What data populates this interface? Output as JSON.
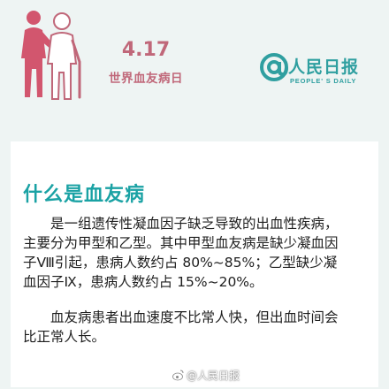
{
  "header": {
    "date": "4.17",
    "event_name": "世界血友病日",
    "brand_name": "人民日报",
    "brand_en": "PEOPLE' S DAILY"
  },
  "card": {
    "title": "什么是血友病",
    "paragraphs": [
      "　　是一组遗传性凝血因子缺乏导致的出血性疾病，主要分为甲型和乙型。其中甲型血友病是缺少凝血因子Ⅷ引起，患病人数约占 80%~85%；乙型缺少凝血因子Ⅸ，患病人数约占 15%~20%。",
      "　　血友病患者出血速度不比常人快，但出血时间会比正常人长。"
    ]
  },
  "watermark": {
    "text": "@人民日报"
  },
  "colors": {
    "background": "#eef4f3",
    "pink": "#c06779",
    "teal": "#2f9fa0",
    "title_teal": "#1aa2a4",
    "card": "#ffffff"
  },
  "icons": [
    "two-people-illustration",
    "at-sign-logo-icon",
    "weibo-icon"
  ]
}
